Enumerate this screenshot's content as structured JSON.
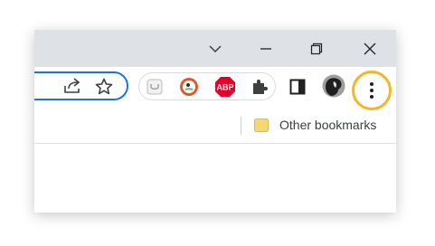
{
  "titlebar": {
    "icons": [
      "chevron-down-icon",
      "minimize-icon",
      "restore-icon",
      "close-icon"
    ]
  },
  "omnibox": {
    "icons": [
      "share-icon",
      "star-icon"
    ]
  },
  "extensions": {
    "items": [
      {
        "name": "pocket",
        "icon": "pocket-icon"
      },
      {
        "name": "duckduckgo",
        "icon": "duckduckgo-icon"
      },
      {
        "name": "adblock-plus",
        "icon": "abp-icon",
        "text": "ABP"
      },
      {
        "name": "extensions-puzzle",
        "icon": "puzzle-icon"
      }
    ]
  },
  "toolbar": {
    "side_panel_icon": "side-panel-icon",
    "avatar_icon": "profile-avatar-icon",
    "menu_icon": "three-dot-menu-icon"
  },
  "bookmarks": {
    "label": "Other bookmarks",
    "icon": "folder-icon"
  },
  "colors": {
    "titlebar_bg": "#dee1e6",
    "accent_blue": "#1a73e8",
    "highlight": "#f7b522",
    "abp_red": "#e4002b",
    "ddg_orange": "#de5833",
    "folder_yellow": "#f7d774"
  }
}
